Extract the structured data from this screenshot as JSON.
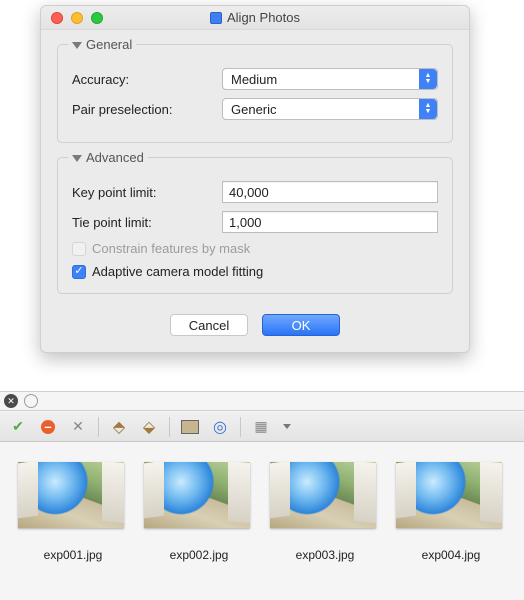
{
  "dialog": {
    "title": "Align Photos",
    "general": {
      "heading": "General",
      "accuracy_label": "Accuracy:",
      "accuracy_value": "Medium",
      "pair_label": "Pair preselection:",
      "pair_value": "Generic"
    },
    "advanced": {
      "heading": "Advanced",
      "keypoint_label": "Key point limit:",
      "keypoint_value": "40,000",
      "tiepoint_label": "Tie point limit:",
      "tiepoint_value": "1,000",
      "constrain_label": "Constrain features by mask",
      "adaptive_label": "Adaptive camera model fitting"
    },
    "cancel": "Cancel",
    "ok": "OK"
  },
  "thumbnails": [
    {
      "name": "exp001.jpg"
    },
    {
      "name": "exp002.jpg"
    },
    {
      "name": "exp003.jpg"
    },
    {
      "name": "exp004.jpg"
    }
  ]
}
